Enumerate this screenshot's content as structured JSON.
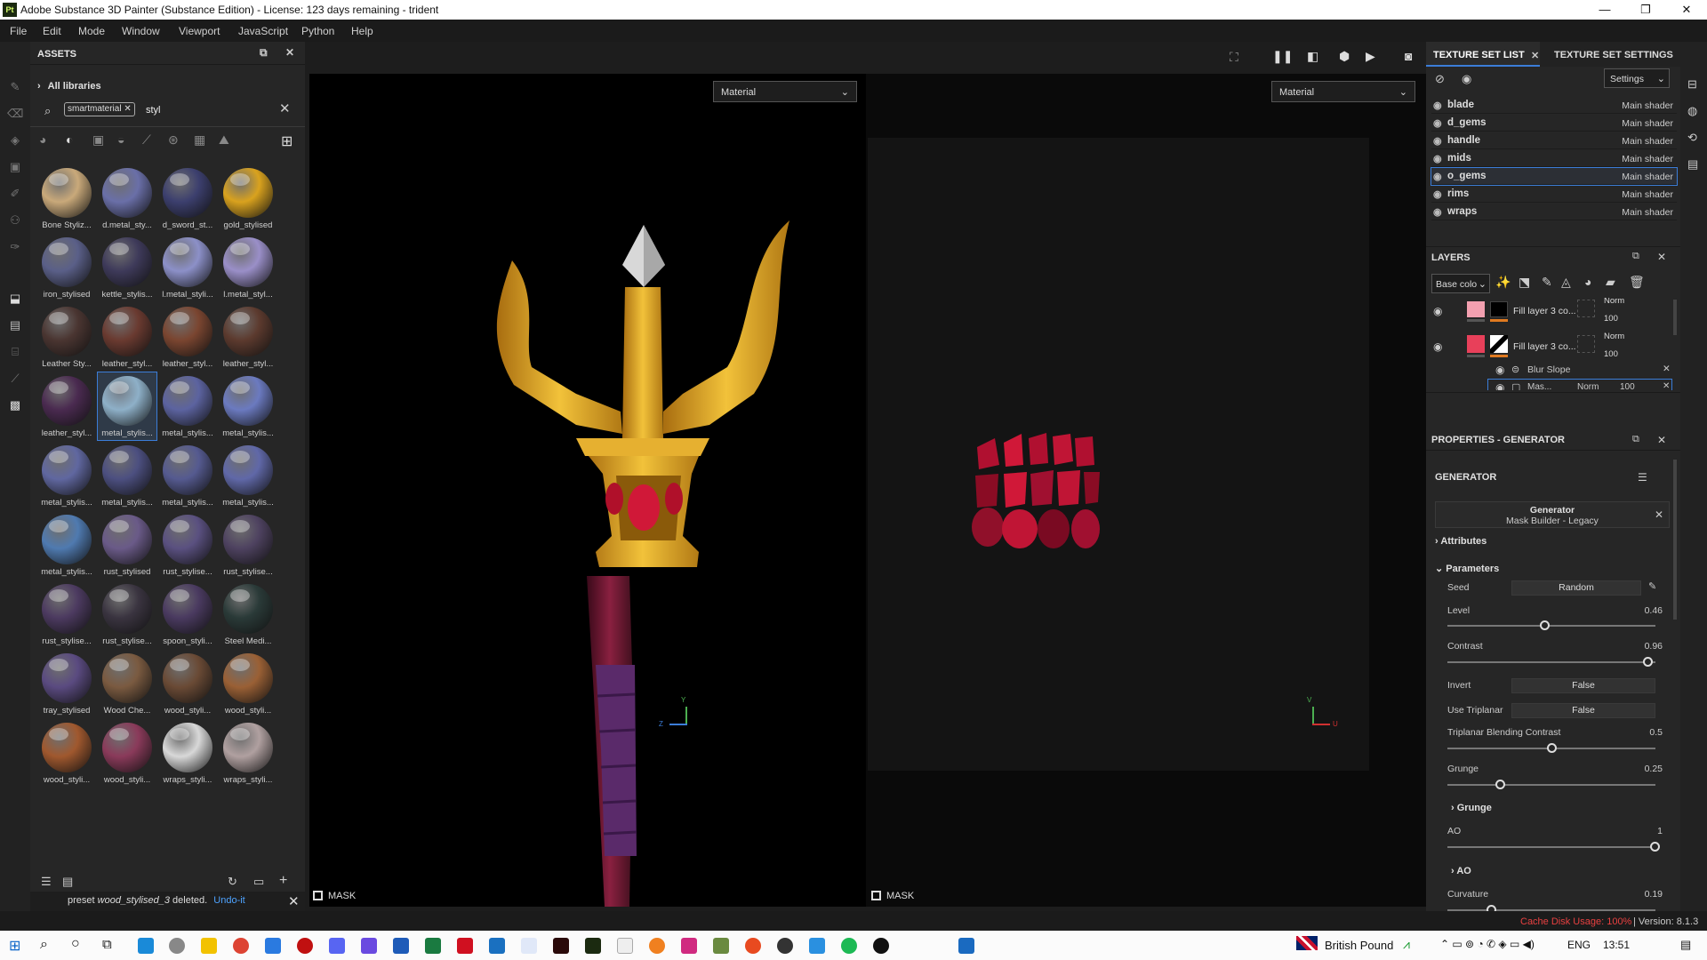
{
  "window": {
    "title": "Adobe Substance 3D Painter (Substance Edition) - License: 123 days remaining - trident",
    "app_icon": "Pt",
    "controls": [
      "—",
      "❐",
      "✕"
    ]
  },
  "menu": [
    "File",
    "Edit",
    "Mode",
    "Window",
    "Viewport",
    "JavaScript",
    "Python",
    "Help"
  ],
  "assets": {
    "title": "ASSETS",
    "library": "All libraries",
    "filter_tag": "smartmaterial",
    "search_value": "styl",
    "items": [
      {
        "label": "Bone Styliz...",
        "color": "#c9a97a"
      },
      {
        "label": "d.metal_sty...",
        "color": "#6a6fa8"
      },
      {
        "label": "d_sword_st...",
        "color": "#3c3f6e"
      },
      {
        "label": "gold_stylised",
        "color": "#d9a21e"
      },
      {
        "label": "iron_stylised",
        "color": "#5a5f88"
      },
      {
        "label": "kettle_stylis...",
        "color": "#3e3a5a"
      },
      {
        "label": "l.metal_styli...",
        "color": "#8c90c8"
      },
      {
        "label": "l.metal_styl...",
        "color": "#9a8fc8"
      },
      {
        "label": "Leather Sty...",
        "color": "#4a3531"
      },
      {
        "label": "leather_styl...",
        "color": "#6a3a30"
      },
      {
        "label": "leather_styl...",
        "color": "#7a4530"
      },
      {
        "label": "leather_styl...",
        "color": "#5c3a2e"
      },
      {
        "label": "leather_styl...",
        "color": "#4a2a50"
      },
      {
        "label": "metal_stylis...",
        "color": "#8eb0c8"
      },
      {
        "label": "metal_stylis...",
        "color": "#5c63a0"
      },
      {
        "label": "metal_stylis...",
        "color": "#6b7ac0"
      },
      {
        "label": "metal_stylis...",
        "color": "#6067a0"
      },
      {
        "label": "metal_stylis...",
        "color": "#4c4f80"
      },
      {
        "label": "metal_stylis...",
        "color": "#555a90"
      },
      {
        "label": "metal_stylis...",
        "color": "#6068a8"
      },
      {
        "label": "metal_stylis...",
        "color": "#4f7ab0"
      },
      {
        "label": "rust_stylised",
        "color": "#6a5a88"
      },
      {
        "label": "rust_stylise...",
        "color": "#5a5080"
      },
      {
        "label": "rust_stylise...",
        "color": "#4e4260"
      },
      {
        "label": "rust_stylise...",
        "color": "#4c3a60"
      },
      {
        "label": "rust_stylise...",
        "color": "#3a3440"
      },
      {
        "label": "spoon_styli...",
        "color": "#4a3a60"
      },
      {
        "label": "Steel Medi...",
        "color": "#2a3a38"
      },
      {
        "label": "tray_stylised",
        "color": "#5a4a80"
      },
      {
        "label": "Wood Che...",
        "color": "#7a5a40"
      },
      {
        "label": "wood_styli...",
        "color": "#6a4a35"
      },
      {
        "label": "wood_styli...",
        "color": "#9a6035"
      },
      {
        "label": "wood_styli...",
        "color": "#a0582e"
      },
      {
        "label": "wood_styli...",
        "color": "#8a3a5a"
      },
      {
        "label": "wraps_styli...",
        "color": "#d8d8d8"
      },
      {
        "label": "wraps_styli...",
        "color": "#b0a0a0"
      }
    ],
    "toast_prefix": "preset ",
    "toast_name": "wood_stylised_3",
    "toast_suffix": "deleted.",
    "toast_undo": "Undo-it"
  },
  "viewport": {
    "left_mode": "Material",
    "right_mode": "Material",
    "left_mask": "MASK",
    "right_mask": "MASK",
    "left_axis_y": "Y",
    "left_axis_z": "Z",
    "right_axis_v": "V",
    "right_axis_u": "U"
  },
  "texture_sets": {
    "tab1": "TEXTURE SET LIST",
    "tab2": "TEXTURE SET SETTINGS",
    "settings": "Settings",
    "rows": [
      {
        "name": "blade",
        "shader": "Main shader"
      },
      {
        "name": "d_gems",
        "shader": "Main shader"
      },
      {
        "name": "handle",
        "shader": "Main shader"
      },
      {
        "name": "mids",
        "shader": "Main shader"
      },
      {
        "name": "o_gems",
        "shader": "Main shader"
      },
      {
        "name": "rims",
        "shader": "Main shader"
      },
      {
        "name": "wraps",
        "shader": "Main shader"
      }
    ]
  },
  "layers": {
    "title": "LAYERS",
    "channel": "Base colo",
    "rows": [
      {
        "name": "Fill layer 3 co...",
        "blend": "Norm",
        "opacity": "100"
      },
      {
        "name": "Fill layer 3 co...",
        "blend": "Norm",
        "opacity": "100"
      }
    ],
    "effect1": "Blur Slope",
    "effect2_name": "Mas...",
    "effect2_blend": "Norm",
    "effect2_opacity": "100"
  },
  "properties": {
    "title": "PROPERTIES - GENERATOR",
    "section": "GENERATOR",
    "gen_name": "Generator",
    "gen_sub": "Mask Builder - Legacy",
    "attributes": "Attributes",
    "parameters": "Parameters",
    "seed_label": "Seed",
    "seed_value": "Random",
    "level_label": "Level",
    "level_value": "0.46",
    "contrast_label": "Contrast",
    "contrast_value": "0.96",
    "invert_label": "Invert",
    "invert_value": "False",
    "triplanar_label": "Use Triplanar",
    "triplanar_value": "False",
    "tbc_label": "Triplanar Blending Contrast",
    "tbc_value": "0.5",
    "grunge_label": "Grunge",
    "grunge_value": "0.25",
    "grunge_section": "Grunge",
    "ao_label": "AO",
    "ao_value": "1",
    "ao_section": "AO",
    "curvature_label": "Curvature",
    "curvature_value": "0.19"
  },
  "status": {
    "cache": "Cache Disk Usage: 100%",
    "version": "| Version: 8.1.3"
  },
  "taskbar": {
    "currency": "British Pound",
    "lang": "ENG",
    "time": "13:51"
  }
}
